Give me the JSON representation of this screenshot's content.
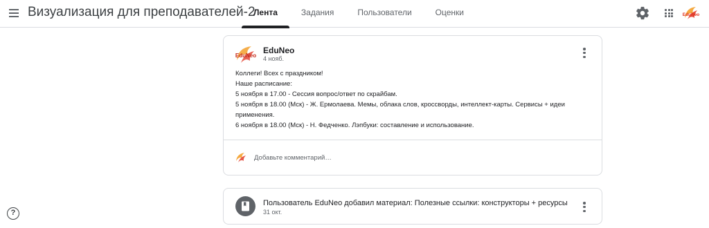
{
  "header": {
    "menu_icon": "hamburger-menu-icon",
    "title": "Визуализация для преподавателей-2",
    "tabs": [
      {
        "label": "Лента",
        "active": true
      },
      {
        "label": "Задания",
        "active": false
      },
      {
        "label": "Пользователи",
        "active": false
      },
      {
        "label": "Оценки",
        "active": false
      }
    ],
    "settings_icon": "gear-icon",
    "apps_icon": "apps-grid-icon",
    "account_logo_text": "EduNeo"
  },
  "post": {
    "author": "EduNeo",
    "date": "4 нояб.",
    "avatar_logo_text": "EduNeo",
    "lines": [
      "Коллеги! Всех с праздником!",
      "Наше расписание:",
      "5 ноября в 17.00 - Сессия вопрос/ответ по скрайбам.",
      "5 ноября в 18.00 (Мск) - Ж. Ермолаева. Мемы, облака слов, кроссворды, интеллект-карты. Сервисы + идеи применения.",
      "6 ноября в 18.00 (Мск) - Н. Федченко. Лэпбуки: составление и использование."
    ],
    "comment_placeholder": "Добавьте комментарий…"
  },
  "material": {
    "text": "Пользователь EduNeo добавил материал: Полезные ссылки: конструкторы + ресурсы",
    "date": "31 окт.",
    "icon": "book-icon"
  },
  "help_label": "?",
  "colors": {
    "logo_orange": "#f39a1e",
    "logo_red": "#e0301e",
    "accent": "#202124",
    "divider": "#dadce0",
    "secondary_text": "#5f6368"
  }
}
